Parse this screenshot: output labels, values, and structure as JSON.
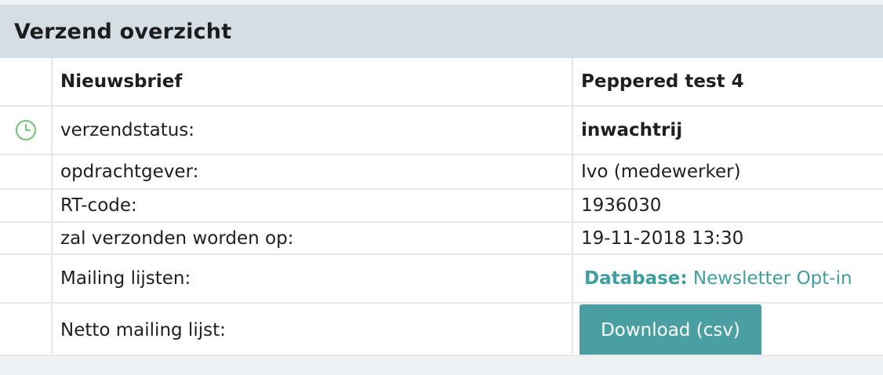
{
  "panel": {
    "title": "Verzend overzicht"
  },
  "rows": [
    {
      "label": "Nieuwsbrief",
      "value": "Peppered test 4"
    },
    {
      "label": "verzendstatus:",
      "value": "inwachtrij",
      "icon": "clock-icon"
    },
    {
      "label": "opdrachtgever:",
      "value": "Ivo (medewerker)"
    },
    {
      "label": "RT-code:",
      "value": "1936030"
    },
    {
      "label": "zal verzonden worden op:",
      "value": "19-11-2018 13:30"
    },
    {
      "label": "Mailing lijsten:",
      "value_prefix": "Database:",
      "value": "Newsletter Opt-in"
    },
    {
      "label": "Netto mailing lijst:",
      "button_label": "Download (csv)"
    }
  ],
  "colors": {
    "accent": "#4a9fa3",
    "link": "#3e9ea1",
    "status_icon": "#7cc47a",
    "header_bg": "#d6dee5"
  }
}
